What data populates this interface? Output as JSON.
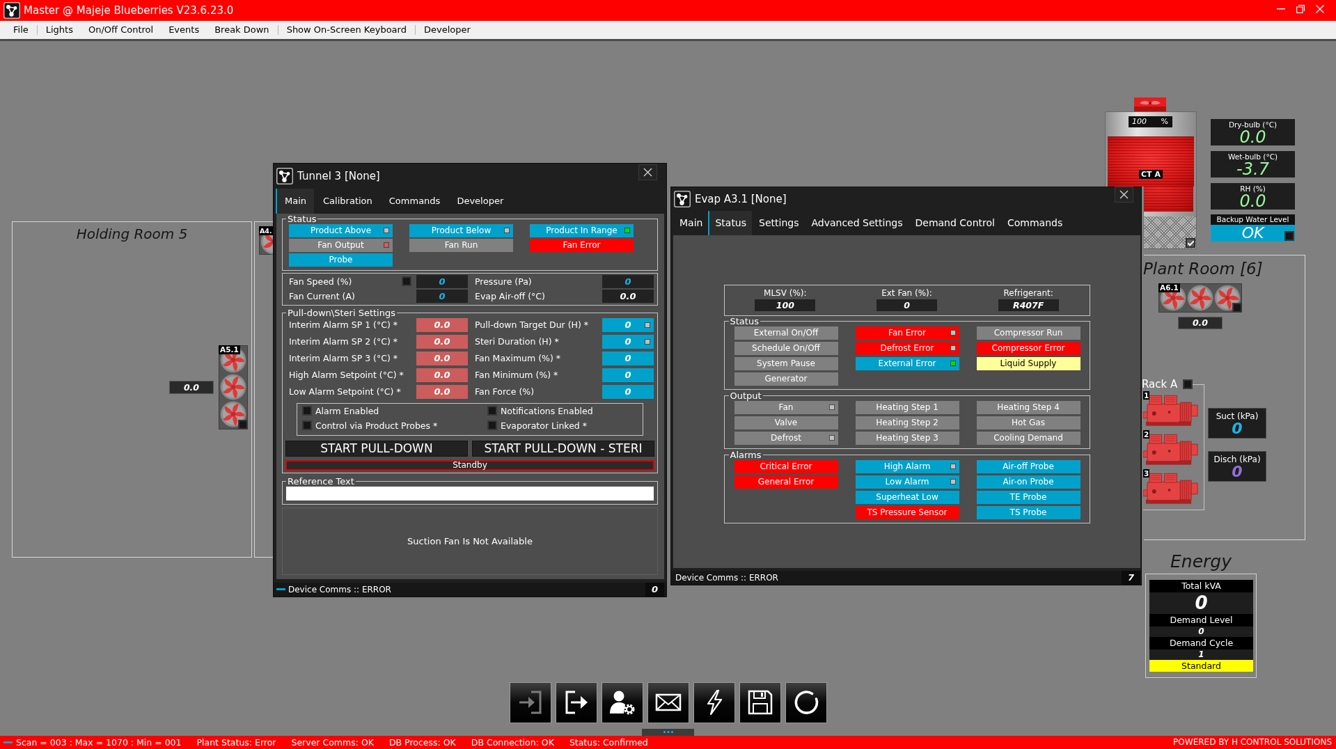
{
  "window": {
    "title": "Master @ Majeje Blueberries V23.6.23.0"
  },
  "menu": [
    {
      "label": "File",
      "separator": false
    },
    {
      "label": "Lights",
      "separator": true
    },
    {
      "label": "On/Off Control",
      "separator": false
    },
    {
      "label": "Events",
      "separator": false
    },
    {
      "label": "Break Down",
      "separator": false
    },
    {
      "label": "Show On-Screen Keyboard",
      "separator": true
    },
    {
      "label": "Developer",
      "separator": true
    }
  ],
  "holding_room": {
    "title": "Holding Room 5",
    "fan_unit": {
      "label": "A5.1",
      "checked": false
    },
    "reading": "0.0"
  },
  "adjacent_room": {
    "fan_unit": {
      "label": "A4."
    }
  },
  "tunnel_window": {
    "title": "Tunnel 3 [None]",
    "tabs": [
      {
        "label": "Main",
        "selected": true
      },
      {
        "label": "Calibration",
        "selected": false
      },
      {
        "label": "Commands",
        "selected": false
      },
      {
        "label": "Developer",
        "selected": false
      }
    ],
    "status": {
      "legend": "Status",
      "items": [
        {
          "label": "Product Above",
          "color": "#00a2cc",
          "indicator": {
            "color": "#c0c0c0"
          }
        },
        {
          "label": "Product Below",
          "color": "#00a2cc",
          "indicator": {
            "color": "#c0c0c0"
          }
        },
        {
          "label": "Product In Range",
          "color": "#00a2cc",
          "indicator": {
            "color": "#00e000"
          }
        },
        {
          "label": "Fan Output",
          "color": "#808080",
          "indicator": {
            "color": "#cd5c5c"
          }
        },
        {
          "label": "Fan Run",
          "color": "#808080"
        },
        {
          "label": "Fan Error",
          "color": "#ff0000"
        },
        {
          "label": "Probe",
          "color": "#00a2cc"
        }
      ]
    },
    "readings": [
      {
        "label": "Fan Speed (%)",
        "value": "0",
        "color": "#1eb4e6",
        "checkbox": {
          "checked": false
        }
      },
      {
        "label": "Pressure (Pa)",
        "value": "0",
        "color": "#1eb4e6"
      },
      {
        "label": "Fan Current (A)",
        "value": "0",
        "color": "#1eb4e6"
      },
      {
        "label": "Evap Air-off (°C)",
        "value": "0.0",
        "color": "#ffffff"
      }
    ],
    "settings": {
      "legend": "Pull-down\\Steri Settings",
      "items": [
        {
          "label": "Interim Alarm SP 1 (°C) *",
          "value": "0.0",
          "color": "#cd5c5c"
        },
        {
          "label": "Pull-down Target Dur (H) *",
          "value": "0",
          "color": "#00a2cc",
          "indicator": {
            "color": "#c0c0c0"
          }
        },
        {
          "label": "Interim Alarm SP 2 (°C) *",
          "value": "0.0",
          "color": "#cd5c5c"
        },
        {
          "label": "Steri Duration (H) *",
          "value": "0",
          "color": "#00a2cc",
          "indicator": {
            "color": "#c0c0c0"
          }
        },
        {
          "label": "Interim Alarm SP 3 (°C) *",
          "value": "0.0",
          "color": "#cd5c5c"
        },
        {
          "label": "Fan Maximum (%) *",
          "value": "0",
          "color": "#00a2cc"
        },
        {
          "label": "High Alarm Setpoint (°C) *",
          "value": "0.0",
          "color": "#cd5c5c"
        },
        {
          "label": "Fan Minimum (%) *",
          "value": "0",
          "color": "#00a2cc"
        },
        {
          "label": "Low Alarm Setpoint (°C) *",
          "value": "0.0",
          "color": "#cd5c5c"
        },
        {
          "label": "Fan Force (%)",
          "value": "0",
          "color": "#00a2cc"
        }
      ],
      "options": [
        {
          "label": "Alarm Enabled",
          "checked": false
        },
        {
          "label": "Notifications Enabled",
          "checked": false
        },
        {
          "label": "Control via Product Probes *",
          "checked": false
        },
        {
          "label": "Evaporator Linked *",
          "checked": false
        }
      ],
      "actions": [
        "START PULL-DOWN",
        "START PULL-DOWN - STERI"
      ],
      "state": "Standby"
    },
    "reference": {
      "legend": "Reference Text"
    },
    "message": "Suction Fan Is Not Available",
    "status_bar": {
      "text": "Device Comms :: ERROR",
      "count": "0",
      "indicator": {
        "color": "#00a2cc"
      }
    }
  },
  "evap_window": {
    "title": "Evap A3.1 [None]",
    "tabs": [
      {
        "label": "Main",
        "selected": false
      },
      {
        "label": "Status",
        "selected": true
      },
      {
        "label": "Settings",
        "selected": false
      },
      {
        "label": "Advanced Settings",
        "selected": false
      },
      {
        "label": "Demand Control",
        "selected": false
      },
      {
        "label": "Commands",
        "selected": false
      }
    ],
    "summary": [
      {
        "label": "MLSV (%):",
        "value": "100"
      },
      {
        "label": "Ext Fan (%):",
        "value": "0"
      },
      {
        "label": "Refrigerant:",
        "value": "R407F"
      }
    ],
    "groups": [
      {
        "legend": "Status",
        "columns": [
          [
            {
              "label": "External On/Off",
              "color": "#808080"
            },
            {
              "label": "Schedule On/Off",
              "color": "#808080"
            },
            {
              "label": "System Pause",
              "color": "#808080"
            },
            {
              "label": "Generator",
              "color": "#808080"
            }
          ],
          [
            {
              "label": "Fan Error",
              "color": "#ff0000",
              "indicator": {
                "color": "#c0c0c0"
              }
            },
            {
              "label": "Defrost Error",
              "color": "#ff0000",
              "indicator": {
                "color": "#c0c0c0"
              }
            },
            {
              "label": "External Error",
              "color": "#00a2cc",
              "indicator": {
                "color": "#00e000"
              }
            }
          ],
          [
            {
              "label": "Compressor Run",
              "color": "#808080"
            },
            {
              "label": "Compressor Error",
              "color": "#ff0000"
            },
            {
              "label": "Liquid Supply",
              "color": "#ffff99"
            }
          ]
        ]
      },
      {
        "legend": "Output",
        "columns": [
          [
            {
              "label": "Fan",
              "color": "#808080",
              "indicator": {
                "color": "#c0c0c0"
              }
            },
            {
              "label": "Valve",
              "color": "#808080"
            },
            {
              "label": "Defrost",
              "color": "#808080",
              "indicator": {
                "color": "#c0c0c0"
              }
            }
          ],
          [
            {
              "label": "Heating Step 1",
              "color": "#808080"
            },
            {
              "label": "Heating Step 2",
              "color": "#808080"
            },
            {
              "label": "Heating Step 3",
              "color": "#808080"
            }
          ],
          [
            {
              "label": "Heating Step 4",
              "color": "#808080"
            },
            {
              "label": "Hot Gas",
              "color": "#808080"
            },
            {
              "label": "Cooling Demand",
              "color": "#808080"
            }
          ]
        ]
      },
      {
        "legend": "Alarms",
        "columns": [
          [
            {
              "label": "Critical Error",
              "color": "#ff0000"
            },
            {
              "label": "General Error",
              "color": "#ff0000"
            }
          ],
          [
            {
              "label": "High Alarm",
              "color": "#00a2cc",
              "indicator": {
                "color": "#c0c0c0"
              }
            },
            {
              "label": "Low Alarm",
              "color": "#00a2cc",
              "indicator": {
                "color": "#c0c0c0"
              }
            },
            {
              "label": "Superheat Low",
              "color": "#00a2cc"
            },
            {
              "label": "TS Pressure Sensor",
              "color": "#ff0000"
            }
          ],
          [
            {
              "label": "Air-off Probe",
              "color": "#00a2cc"
            },
            {
              "label": "Air-on Probe",
              "color": "#00a2cc"
            },
            {
              "label": "TE Probe",
              "color": "#00a2cc"
            },
            {
              "label": "TS Probe",
              "color": "#00a2cc"
            }
          ]
        ]
      }
    ],
    "status_bar": {
      "text": "Device Comms :: ERROR",
      "count": "7"
    }
  },
  "cooling_tower": {
    "label": "CT A",
    "speed": "100",
    "unit": "%",
    "checked": true
  },
  "sensors": [
    {
      "label": "Dry-bulb (°C)",
      "value": "0.0"
    },
    {
      "label": "Wet-bulb (°C)",
      "value": "-3.7"
    },
    {
      "label": "RH (%)",
      "value": "0.0"
    }
  ],
  "backup_water": {
    "label": "Backup Water Level",
    "value": "OK",
    "checked": false
  },
  "plant_room": {
    "title": "Plant Room [6]",
    "fan_unit": {
      "label": "A6.1",
      "checked": false
    },
    "reading": "0.0",
    "rack": {
      "title": "Rack A",
      "checked": false,
      "compressors": [
        {
          "label": "1"
        },
        {
          "label": "2"
        },
        {
          "label": "3"
        }
      ]
    },
    "pressures": [
      {
        "label": "Suct (kPa)",
        "value": "0",
        "color": "#1eb4e6"
      },
      {
        "label": "Disch (kPa)",
        "value": "0",
        "color": "#9370db"
      }
    ]
  },
  "energy": {
    "title": "Energy",
    "rows": [
      {
        "label": "Total kVA",
        "value": "0",
        "kind": "large"
      },
      {
        "label": "Demand Level",
        "value": "0",
        "kind": "small"
      },
      {
        "label": "Demand Cycle",
        "value": "1",
        "kind": "small"
      }
    ],
    "mode": "Standard"
  },
  "toolbar": [
    {
      "kind": "sign_in",
      "disabled": true
    },
    {
      "kind": "sign_out",
      "disabled": false
    },
    {
      "kind": "user_settings",
      "disabled": false
    },
    {
      "kind": "mail",
      "disabled": false
    },
    {
      "kind": "power",
      "disabled": false
    },
    {
      "kind": "save",
      "disabled": false
    },
    {
      "kind": "refresh",
      "disabled": false
    }
  ],
  "status_bar": {
    "indicator": {
      "color": "#00a2cc"
    },
    "items": [
      "Scan = 003 : Max = 1070 : Min = 001",
      "Plant Status: Error",
      "Server Comms: OK",
      "DB Process: OK",
      "DB Connection: OK",
      "Status: Confirmed"
    ],
    "credit": "POWERED BY H CONTROL SOLUTIONS"
  }
}
